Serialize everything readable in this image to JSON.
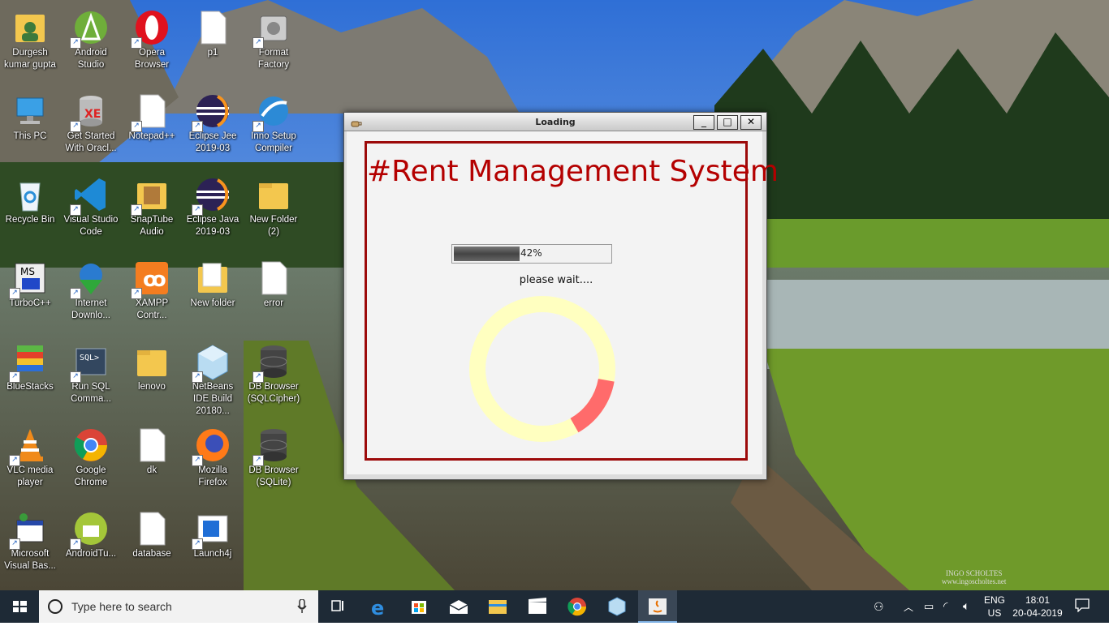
{
  "desktop": {
    "icons": [
      {
        "label": "Durgesh kumar gupta"
      },
      {
        "label": "Android Studio"
      },
      {
        "label": "Opera Browser"
      },
      {
        "label": "p1"
      },
      {
        "label": "Format Factory"
      },
      {
        "label": "This PC"
      },
      {
        "label": "Get Started With Oracl..."
      },
      {
        "label": "Notepad++"
      },
      {
        "label": "Eclipse Jee 2019-03"
      },
      {
        "label": "Inno Setup Compiler"
      },
      {
        "label": "Recycle Bin"
      },
      {
        "label": "Visual Studio Code"
      },
      {
        "label": "SnapTube Audio"
      },
      {
        "label": "Eclipse Java 2019-03"
      },
      {
        "label": "New Folder (2)"
      },
      {
        "label": "TurboC++"
      },
      {
        "label": "Internet Downlo..."
      },
      {
        "label": "XAMPP Contr..."
      },
      {
        "label": "New folder"
      },
      {
        "label": "error"
      },
      {
        "label": "BlueStacks"
      },
      {
        "label": "Run SQL Comma..."
      },
      {
        "label": "lenovo"
      },
      {
        "label": "NetBeans IDE Build 20180..."
      },
      {
        "label": "DB Browser (SQLCipher)"
      },
      {
        "label": "VLC media player"
      },
      {
        "label": "Google Chrome"
      },
      {
        "label": "dk"
      },
      {
        "label": "Mozilla Firefox"
      },
      {
        "label": "DB Browser (SQLite)"
      },
      {
        "label": "Microsoft Visual Bas..."
      },
      {
        "label": "AndroidTu..."
      },
      {
        "label": "database"
      },
      {
        "label": "Launch4j"
      }
    ]
  },
  "dialog": {
    "title": "Loading",
    "app_title": "#Rent Management System",
    "progress": {
      "value": 0.42,
      "text": "42%"
    },
    "wait_text": "please wait....",
    "spinner": {
      "ring_color": "#ffffc0",
      "arc_color": "#ff6b6b",
      "arc_fraction": 0.14
    },
    "buttons": {
      "minimize": "_",
      "maximize": "□",
      "close": "✕"
    }
  },
  "taskbar": {
    "search_placeholder": "Type here to search",
    "apps": [
      "task-view-icon",
      "edge-icon",
      "store-icon",
      "mail-icon",
      "file-explorer-icon",
      "movies-icon",
      "chrome-icon",
      "app-icon",
      "java-icon"
    ],
    "lang_top": "ENG",
    "lang_bottom": "US",
    "time": "18:01",
    "date": "20-04-2019"
  },
  "watermark": {
    "line1": "INGO SCHOLTES",
    "line2": "www.ingoscholtes.net"
  }
}
